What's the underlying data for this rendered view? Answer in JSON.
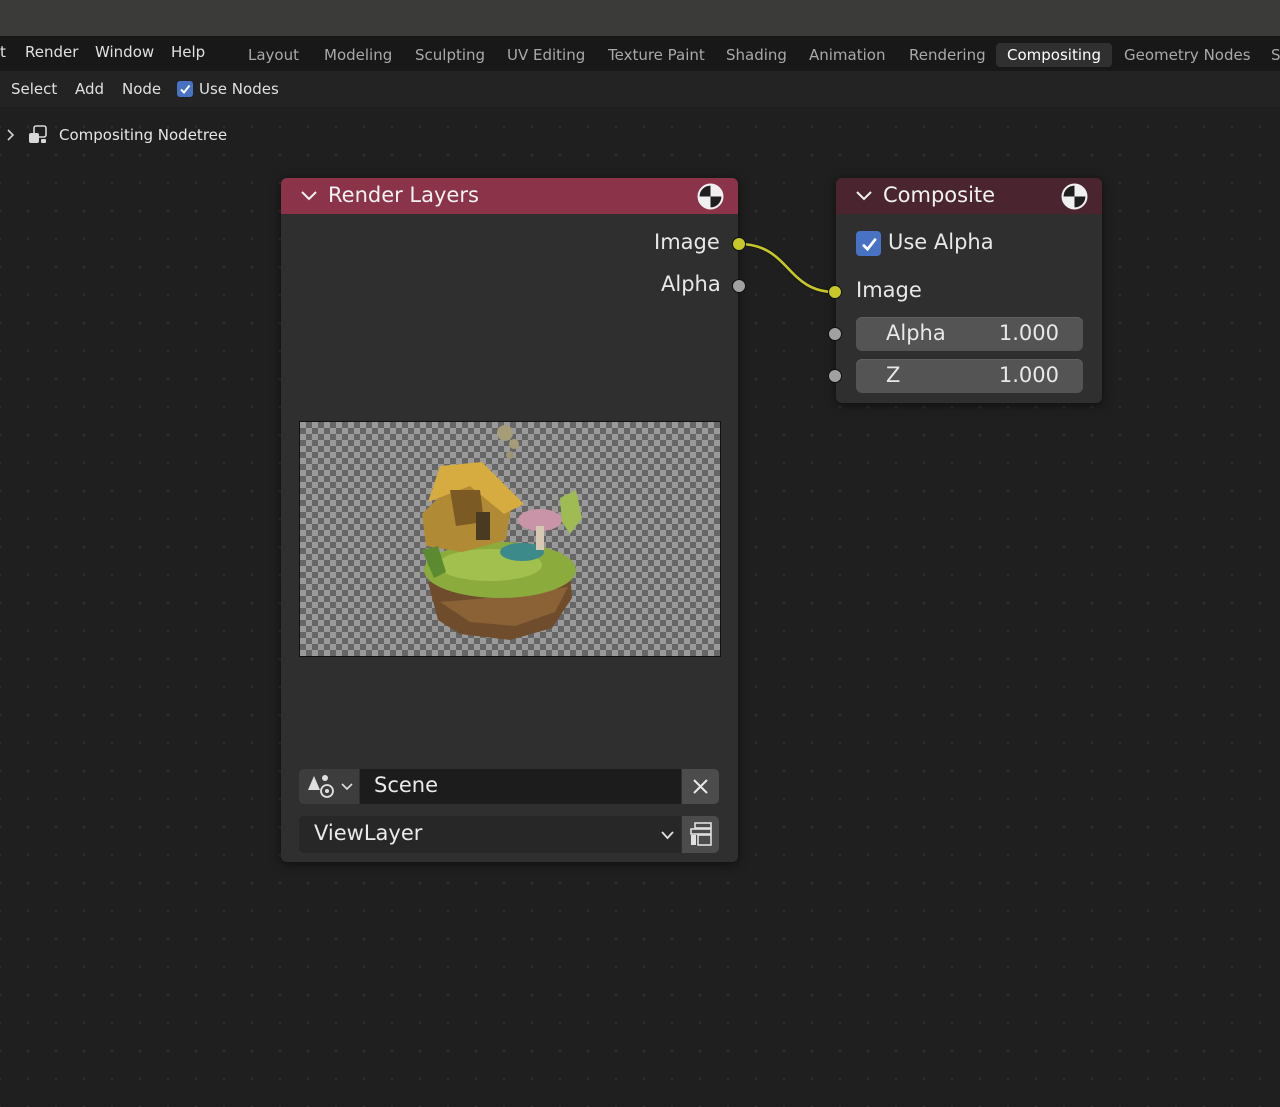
{
  "menubar": {
    "partial_item": "t",
    "items": [
      "Render",
      "Window",
      "Help"
    ]
  },
  "workspace_tabs": {
    "tabs": [
      "Layout",
      "Modeling",
      "Sculpting",
      "UV Editing",
      "Texture Paint",
      "Shading",
      "Animation",
      "Rendering",
      "Compositing",
      "Geometry Nodes",
      "S"
    ],
    "active": "Compositing"
  },
  "header": {
    "select": "Select",
    "add": "Add",
    "node": "Node",
    "use_nodes": {
      "label": "Use Nodes",
      "checked": true
    }
  },
  "breadcrumb": {
    "label": "Compositing Nodetree"
  },
  "render_layers_node": {
    "title": "Render Layers",
    "header_color": "#8b3349",
    "outputs": [
      {
        "name": "Image",
        "color": "#c7c729"
      },
      {
        "name": "Alpha",
        "color": "#a1a1a1"
      }
    ],
    "scene_field": "Scene",
    "view_layer": "ViewLayer"
  },
  "composite_node": {
    "title": "Composite",
    "header_color": "#4a2530",
    "use_alpha": {
      "label": "Use Alpha",
      "checked": true
    },
    "inputs": [
      {
        "name": "Image",
        "color": "#c7c729"
      },
      {
        "name": "Alpha",
        "value": "1.000"
      },
      {
        "name": "Z",
        "value": "1.000"
      }
    ]
  },
  "link_color": "#c7c729",
  "icons": [
    "chevron-right-icon",
    "node-tree-icon",
    "collapse-chevron-icon",
    "render-preview-sphere-icon",
    "checkmark-icon",
    "scene-data-icon",
    "close-icon",
    "dropdown-chevron-icon",
    "render-layer-icon"
  ]
}
